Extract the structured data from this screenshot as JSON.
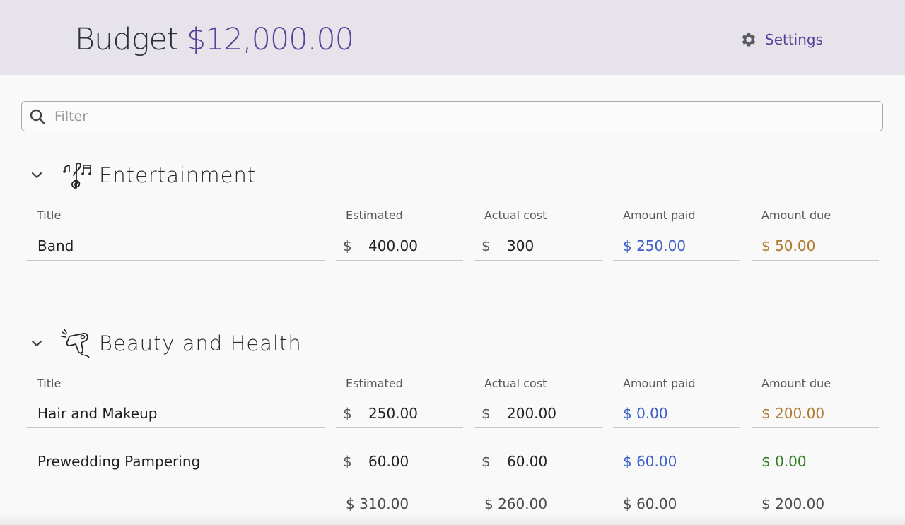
{
  "header": {
    "budget_label": "Budget",
    "budget_amount": "$12,000.00",
    "settings_label": "Settings"
  },
  "filter": {
    "placeholder": "Filter"
  },
  "columns": {
    "title": "Title",
    "estimated": "Estimated",
    "actual": "Actual cost",
    "paid": "Amount paid",
    "due": "Amount due"
  },
  "sections": [
    {
      "title": "Entertainment",
      "icon": "music-notes-icon",
      "rows": [
        {
          "title": "Band",
          "estimated": "400.00",
          "actual": "300",
          "paid": "$ 250.00",
          "due": "$ 50.00"
        }
      ]
    },
    {
      "title": "Beauty and Health",
      "icon": "hair-dryer-icon",
      "rows": [
        {
          "title": "Hair and Makeup",
          "estimated": "250.00",
          "actual": "200.00",
          "paid": "$ 0.00",
          "due": "$ 200.00"
        },
        {
          "title": "Prewedding Pampering",
          "estimated": "60.00",
          "actual": "60.00",
          "paid": "$ 60.00",
          "due": "$ 0.00"
        }
      ],
      "totals": {
        "estimated": "$ 310.00",
        "actual": "$ 260.00",
        "paid": "$ 60.00",
        "due": "$ 200.00"
      }
    }
  ],
  "currency_symbol": "$",
  "colors": {
    "accent": "#5b3f98",
    "paid": "#3c5fc4",
    "due_outstanding": "#b07a2e",
    "due_settled": "#2f7d1f"
  }
}
